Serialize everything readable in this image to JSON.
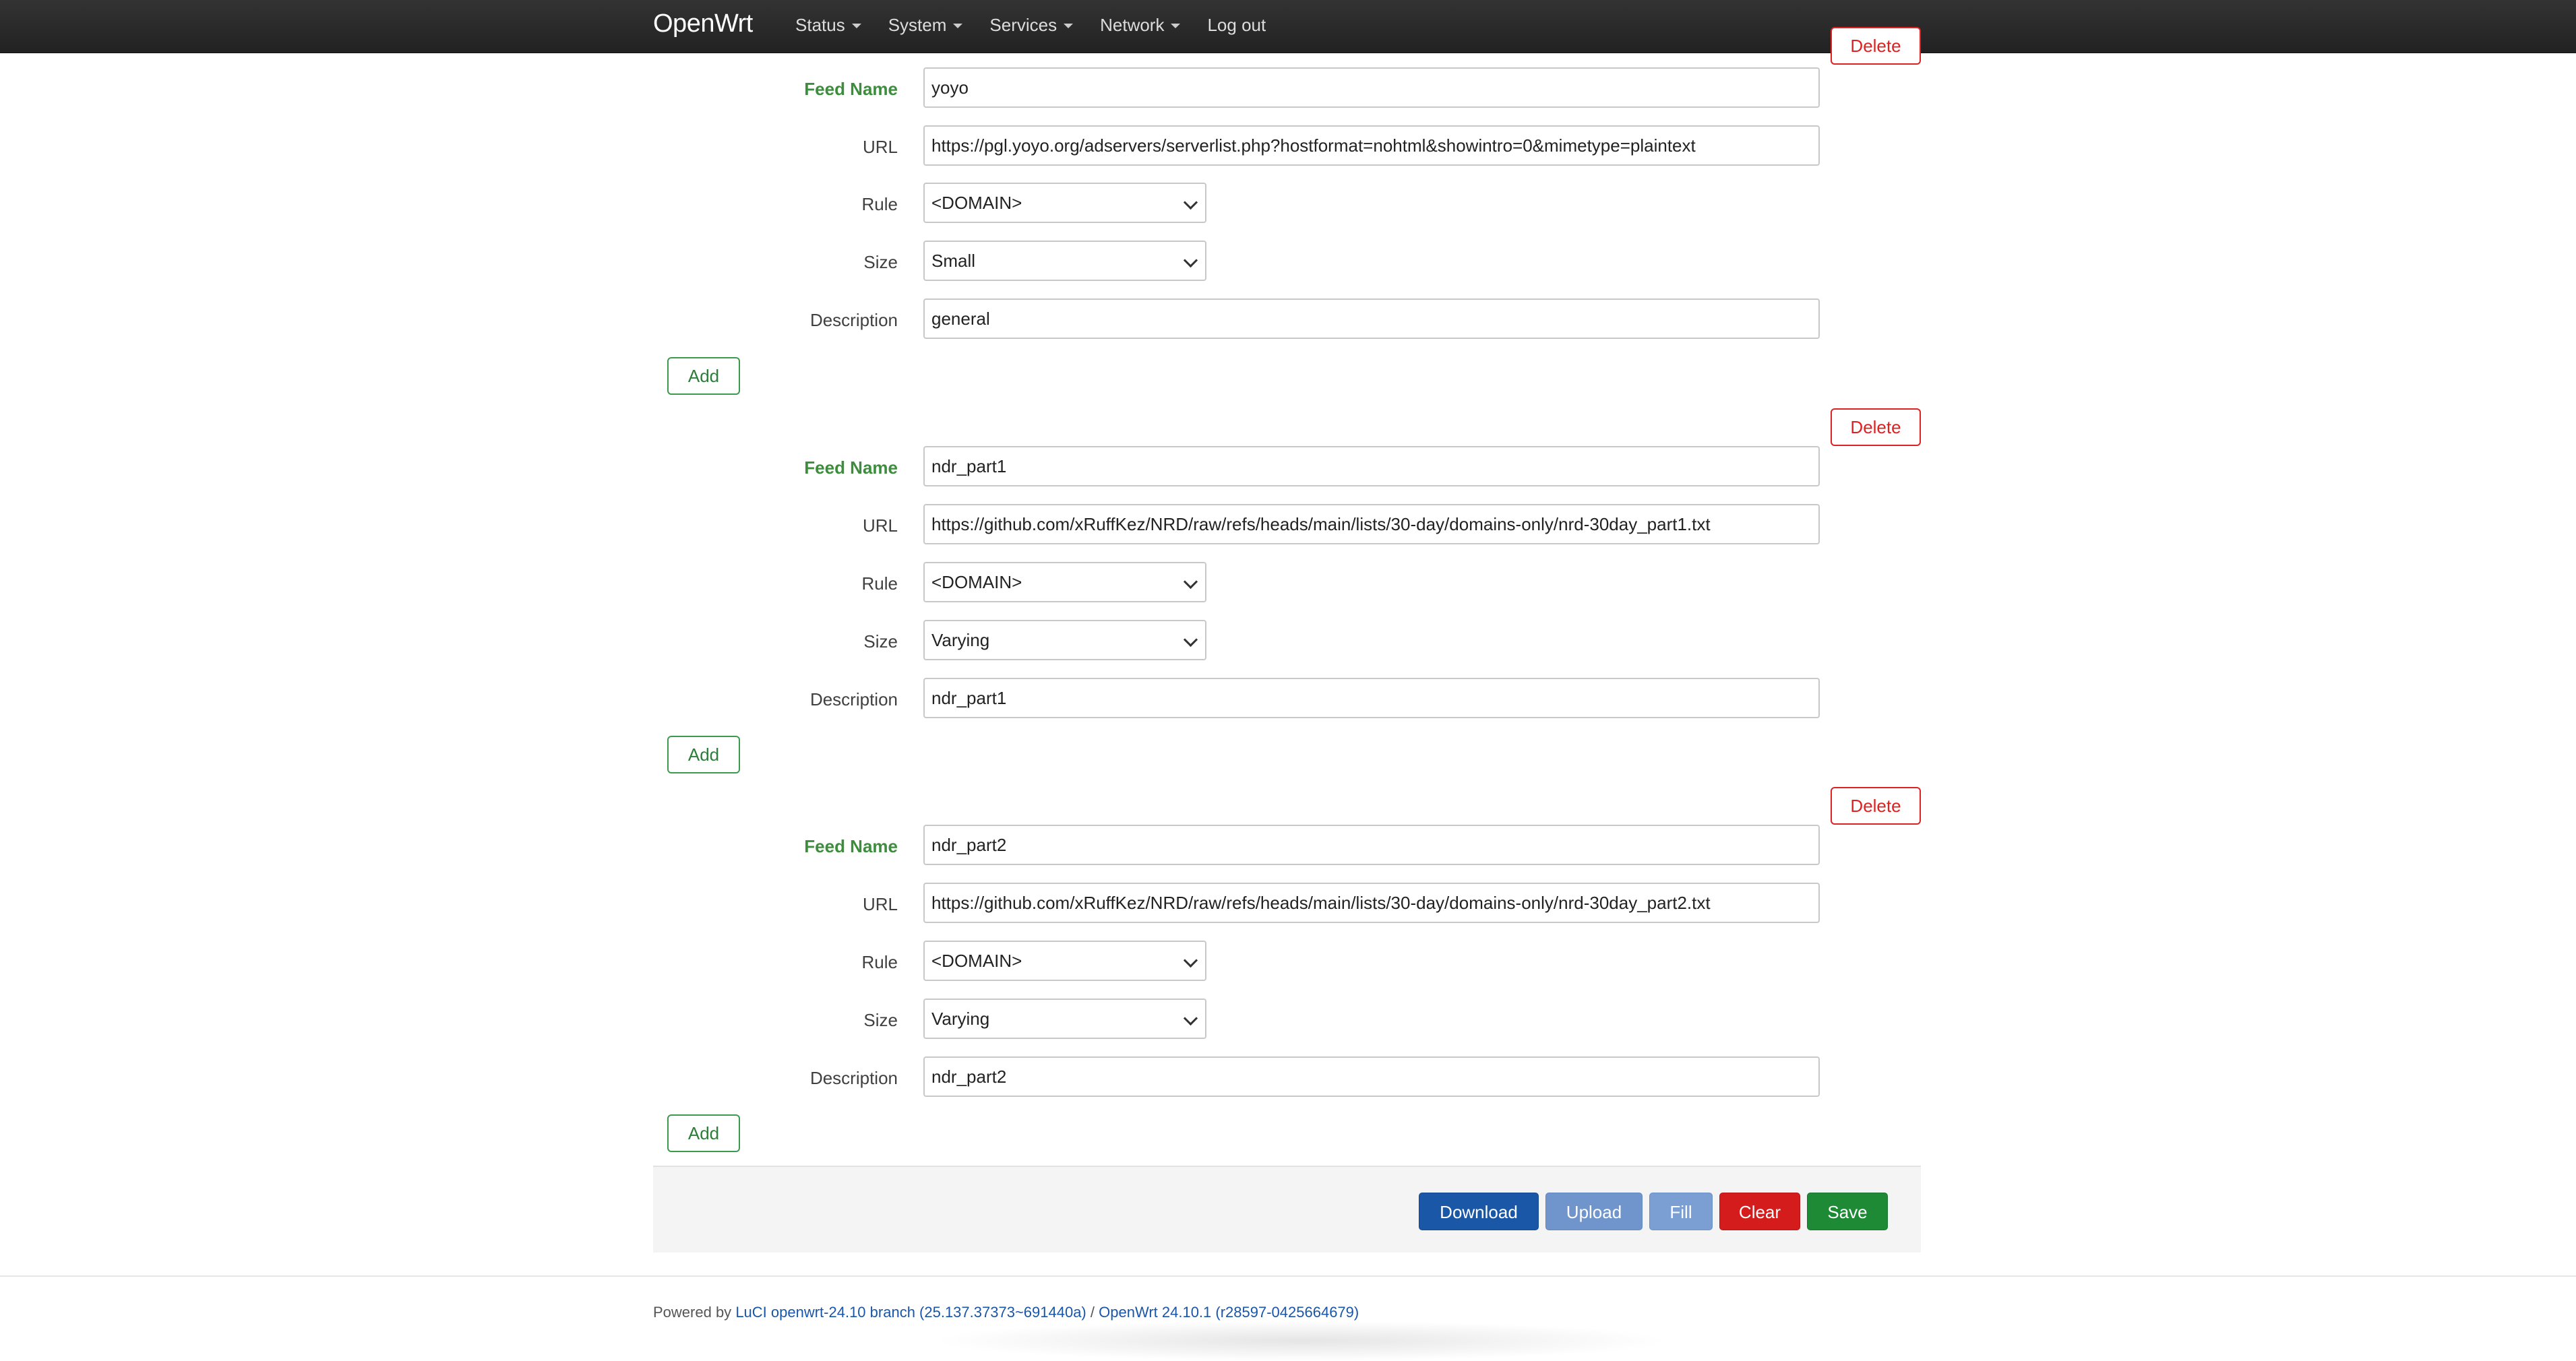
{
  "navbar": {
    "brand": "OpenWrt",
    "menu": [
      {
        "label": "Status"
      },
      {
        "label": "System"
      },
      {
        "label": "Services"
      },
      {
        "label": "Network"
      },
      {
        "label": "Log out"
      }
    ]
  },
  "labels": {
    "feed_name": "Feed Name",
    "url": "URL",
    "rule": "Rule",
    "size": "Size",
    "description": "Description",
    "add": "Add",
    "delete": "Delete"
  },
  "feeds": [
    {
      "feed_name": "yoyo",
      "url": "https://pgl.yoyo.org/adservers/serverlist.php?hostformat=nohtml&showintro=0&mimetype=plaintext",
      "rule": "<DOMAIN>",
      "size": "Small",
      "description": "general"
    },
    {
      "feed_name": "ndr_part1",
      "url": "https://github.com/xRuffKez/NRD/raw/refs/heads/main/lists/30-day/domains-only/nrd-30day_part1.txt",
      "rule": "<DOMAIN>",
      "size": "Varying",
      "description": "ndr_part1"
    },
    {
      "feed_name": "ndr_part2",
      "url": "https://github.com/xRuffKez/NRD/raw/refs/heads/main/lists/30-day/domains-only/nrd-30day_part2.txt",
      "rule": "<DOMAIN>",
      "size": "Varying",
      "description": "ndr_part2"
    }
  ],
  "actions": {
    "download": "Download",
    "upload": "Upload",
    "fill": "Fill",
    "clear": "Clear",
    "save": "Save"
  },
  "footer": {
    "powered_by": "Powered by",
    "luci_link": "LuCI openwrt-24.10 branch (25.137.37373~691440a)",
    "separator": "/",
    "openwrt_link": "OpenWrt 24.10.1 (r28597-0425664679)"
  },
  "colors": {
    "navbar_bg": "#2a2a2a",
    "required_label": "#3c8d3c",
    "add_border": "#3c9a4c",
    "delete_border": "#dd2222",
    "download": "#1b57a7",
    "upload": "#6f95cc",
    "fill": "#7b9fd3",
    "clear": "#d41c1c",
    "save": "#1e8a36",
    "link": "#1a56a8"
  }
}
